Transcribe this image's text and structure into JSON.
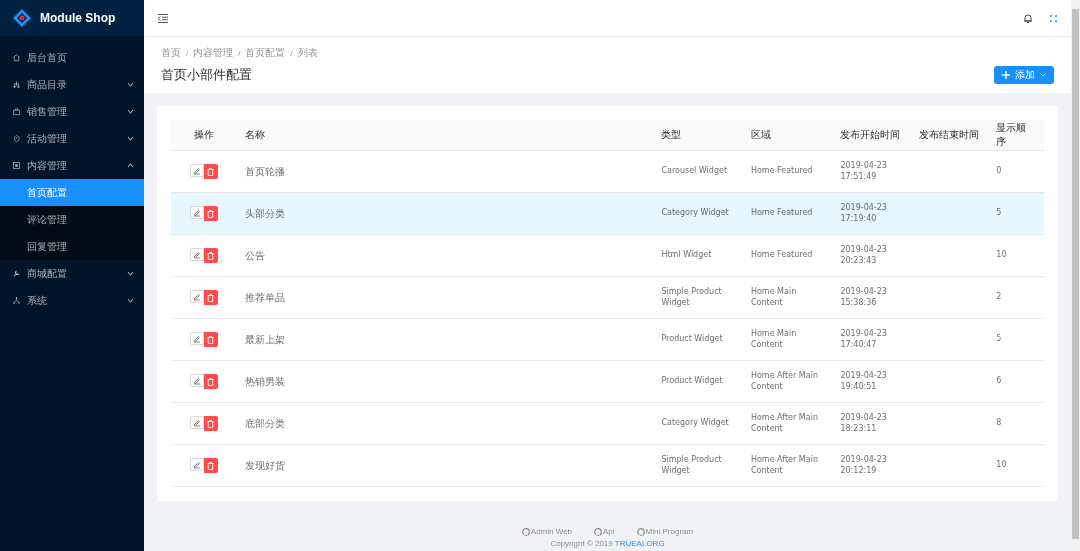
{
  "brand": {
    "name": "Module Shop"
  },
  "sidebar": {
    "items": [
      {
        "label": "后台首页",
        "kind": "link",
        "selected": false
      },
      {
        "label": "商品目录",
        "kind": "submenu",
        "expanded": false,
        "selected": false
      },
      {
        "label": "销售管理",
        "kind": "submenu",
        "expanded": false,
        "selected": false
      },
      {
        "label": "活动管理",
        "kind": "submenu",
        "expanded": false,
        "selected": false
      },
      {
        "label": "内容管理",
        "kind": "submenu",
        "expanded": true,
        "selected": false,
        "children": [
          {
            "label": "首页配置",
            "selected": true
          },
          {
            "label": "评论管理",
            "selected": false
          },
          {
            "label": "回复管理",
            "selected": false
          }
        ]
      },
      {
        "label": "商城配置",
        "kind": "submenu",
        "expanded": false,
        "selected": false
      },
      {
        "label": "系统",
        "kind": "submenu",
        "expanded": false,
        "selected": false
      }
    ]
  },
  "breadcrumb": {
    "separator": "/",
    "items": [
      "首页",
      "内容管理",
      "首页配置",
      "列表"
    ]
  },
  "page_title": "首页小部件配置",
  "add_button": {
    "label": "添加"
  },
  "table": {
    "columns": [
      "操作",
      "名称",
      "类型",
      "区域",
      "发布开始时间",
      "发布结束时间",
      "显示顺序"
    ],
    "rows": [
      {
        "name": "首页轮播",
        "type": "Carousel Widget",
        "region": "Home Featured",
        "start": "2019-04-23 17:51:49",
        "order": "0",
        "highlighted": false
      },
      {
        "name": "头部分类",
        "type": "Category Widget",
        "region": "Home Featured",
        "start": "2019-04-23 17:19:40",
        "order": "5",
        "highlighted": true
      },
      {
        "name": "公告",
        "type": "Html Widget",
        "region": "Home Featured",
        "start": "2019-04-23 20:23:43",
        "order": "10",
        "highlighted": false
      },
      {
        "name": "推荐单品",
        "type": "Simple Product Widget",
        "region": "Home Main Content",
        "start": "2019-04-23 15:38:36",
        "order": "2",
        "highlighted": false
      },
      {
        "name": "最新上架",
        "type": "Product Widget",
        "region": "Home Main Content",
        "start": "2019-04-23 17:40:47",
        "order": "5",
        "highlighted": false
      },
      {
        "name": "热销男装",
        "type": "Product Widget",
        "region": "Home After Main Content",
        "start": "2019-04-23 19:40:51",
        "order": "6",
        "highlighted": false
      },
      {
        "name": "底部分类",
        "type": "Category Widget",
        "region": "Home After Main Content",
        "start": "2019-04-23 18:23:11",
        "order": "8",
        "highlighted": false
      },
      {
        "name": "发现好货",
        "type": "Simple Product Widget",
        "region": "Home After Main Content",
        "start": "2019-04-23 20:12:19",
        "order": "10",
        "highlighted": false
      }
    ]
  },
  "footer": {
    "links": [
      "Admin Web",
      "Api",
      "Mini Program"
    ],
    "copyright": "Copyright © 2019",
    "copyright_link": "TRUEAI.ORG"
  }
}
